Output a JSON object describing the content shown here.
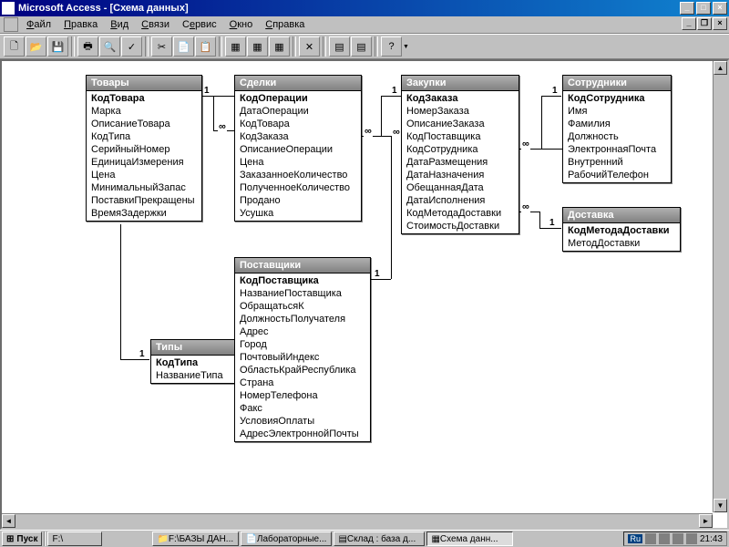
{
  "app": {
    "title": "Microsoft Access - [Схема данных]"
  },
  "menu": {
    "file": "Файл",
    "edit": "Правка",
    "view": "Вид",
    "relations": "Связи",
    "service": "Сервис",
    "window": "Окно",
    "help": "Справка"
  },
  "tables": {
    "tovary": {
      "title": "Товары",
      "pk": "КодТовара",
      "fields": [
        "Марка",
        "ОписаниеТовара",
        "КодТипа",
        "СерийныйНомер",
        "ЕдиницаИзмерения",
        "Цена",
        "МинимальныйЗапас",
        "ПоставкиПрекращены",
        "ВремяЗадержки"
      ]
    },
    "sdelki": {
      "title": "Сделки",
      "pk": "КодОперации",
      "fields": [
        "ДатаОперации",
        "КодТовара",
        "КодЗаказа",
        "ОписаниеОперации",
        "Цена",
        "ЗаказанноеКоличество",
        "ПолученноеКоличество",
        "Продано",
        "Усушка"
      ]
    },
    "zakupki": {
      "title": "Закупки",
      "pk": "КодЗаказа",
      "fields": [
        "НомерЗаказа",
        "ОписаниеЗаказа",
        "КодПоставщика",
        "КодСотрудника",
        "ДатаРазмещения",
        "ДатаНазначения",
        "ОбещаннаяДата",
        "ДатаИсполнения",
        "КодМетодаДоставки",
        "СтоимостьДоставки"
      ]
    },
    "sotrudniki": {
      "title": "Сотрудники",
      "pk": "КодСотрудника",
      "fields": [
        "Имя",
        "Фамилия",
        "Должность",
        "ЭлектроннаяПочта",
        "Внутренний",
        "РабочийТелефон"
      ]
    },
    "dostavka": {
      "title": "Доставка",
      "pk": "КодМетодаДоставки",
      "fields": [
        "МетодДоставки"
      ]
    },
    "tipy": {
      "title": "Типы",
      "pk": "КодТипа",
      "fields": [
        "НазваниеТипа"
      ]
    },
    "postavshiki": {
      "title": "Поставщики",
      "pk": "КодПоставщика",
      "fields": [
        "НазваниеПоставщика",
        "ОбращатьсяК",
        "ДолжностьПолучателя",
        "Адрес",
        "Город",
        "ПочтовыйИндекс",
        "ОбластьКрайРеспублика",
        "Страна",
        "НомерТелефона",
        "Факс",
        "УсловияОплаты",
        "АдресЭлектроннойПочты"
      ]
    }
  },
  "rel": {
    "one": "1",
    "many": "∞"
  },
  "taskbar": {
    "start": "Пуск",
    "btn1": "F:\\",
    "btn2": "F:\\БАЗЫ ДАН...",
    "btn3": "Лабораторные...",
    "btn4": "Склад : база д...",
    "btn5": "Схема данн...",
    "lang": "Ru",
    "time": "21:43"
  }
}
